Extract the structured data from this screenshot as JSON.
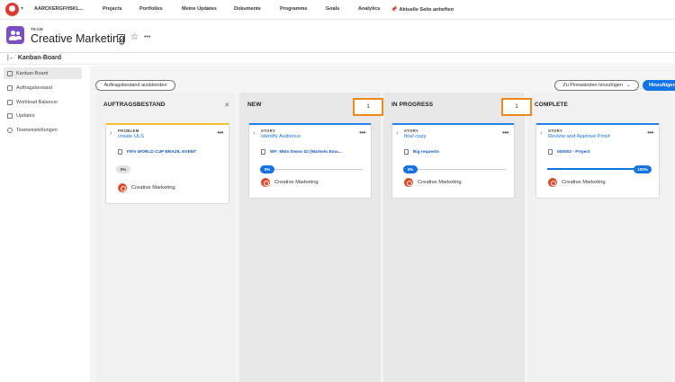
{
  "nav": {
    "workspace": "AARCKERGFHSKL...",
    "items": [
      "Projects",
      "Portfolios",
      "Meine Updates",
      "Dokumente",
      "Programme",
      "Goals",
      "Analytics",
      "Aktuelle Seite anheften"
    ]
  },
  "header": {
    "team_label": "TEAM",
    "team_name": "Creative Marketing",
    "more_label": "•••"
  },
  "board": {
    "title": "Kanban-Board",
    "hide_backlog": "Auftragsbestand ausblenden",
    "pin_dropdown": "Zu Pinnwänden hinzufügen",
    "add_button": "Hinzufügen"
  },
  "sidebar": {
    "items": [
      "Kanban-Board",
      "Auftragsbestand",
      "Workload Balancer",
      "Updates",
      "Teameinstellungen"
    ]
  },
  "columns": [
    {
      "name": "AUFTRAGSBESTAND",
      "count": ""
    },
    {
      "name": "NEW",
      "count": "1"
    },
    {
      "name": "IN PROGRESS",
      "count": "1"
    },
    {
      "name": "COMPLETE",
      "count": ""
    }
  ],
  "cards": [
    {
      "type": "PROBLEM",
      "title": "create ULS",
      "project": "FIFA WORLD CUP BRAZIL EVENT",
      "progress": 0,
      "progress_label": "0%",
      "owner": "Creative Marketing"
    },
    {
      "type": "STORY",
      "title": "Identify Audience",
      "project": "WF: Mkto Demo 02 [Marketo Ema...",
      "progress": 0,
      "progress_label": "0%",
      "owner": "Creative Marketing"
    },
    {
      "type": "STORY",
      "title": "final copy",
      "project": "Big requests",
      "progress": 0,
      "progress_label": "0%",
      "owner": "Creative Marketing"
    },
    {
      "type": "STORY",
      "title": "Review and Approve Proof",
      "project": "000002 - Project",
      "progress": 100,
      "progress_label": "100%",
      "owner": "Creative Marketing"
    }
  ],
  "colors": {
    "accent": "#1473e6",
    "highlight": "#f0891a",
    "team": "#7c4dc4",
    "backlog_bar": "#f2c12e"
  }
}
